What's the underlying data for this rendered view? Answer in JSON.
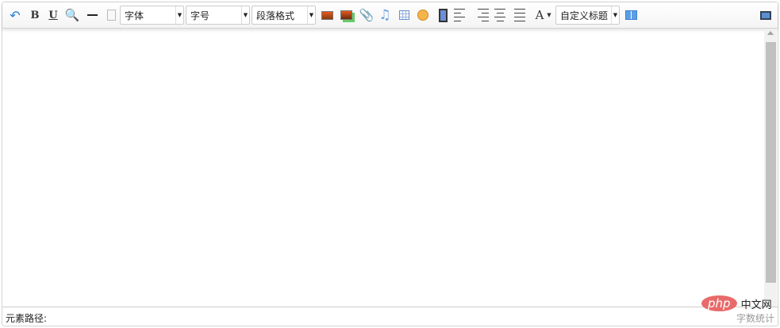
{
  "toolbar": {
    "bold": "B",
    "underline": "U",
    "font_label": "字体",
    "size_label": "字号",
    "paragraph_label": "段落格式",
    "fontcolor": "A",
    "custom_title_label": "自定义标题"
  },
  "statusbar": {
    "path_label": "元素路径:",
    "word_count": "字数统计"
  },
  "watermark": {
    "logo": "php",
    "text": "中文网"
  }
}
